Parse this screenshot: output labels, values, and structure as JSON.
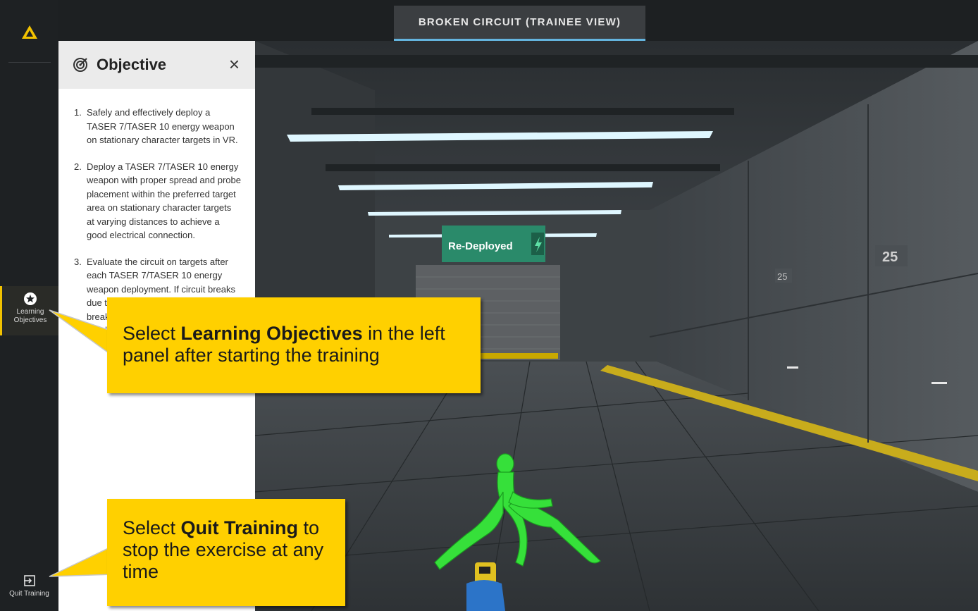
{
  "app": {
    "title": "BROKEN CIRCUIT (TRAINEE VIEW)"
  },
  "rail": {
    "logo_icon": "warning-triangle-logo",
    "learning_objectives_label": "Learning Objectives",
    "learning_objectives_icon": "star-circle-icon",
    "quit_label": "Quit Training",
    "quit_icon": "exit-icon"
  },
  "objective_panel": {
    "title": "Objective",
    "close_icon": "close-icon",
    "close_glyph": "×",
    "items": [
      {
        "num": "1.",
        "text": "Safely and effectively deploy a TASER 7/TASER 10 energy weapon on stationary character targets in VR."
      },
      {
        "num": "2.",
        "text": "Deploy a TASER 7/TASER 10 energy weapon with proper spread and probe placement within the preferred target area on stationary character targets at varying distances to achieve a good electrical connection."
      },
      {
        "num": "3.",
        "text": "Evaluate the circuit on targets after each TASER 7/TASER 10 energy weapon deployment. If circuit breaks due to probe bounce, disconnect, or breakage, re-deploy to achieve a good electrical connection."
      }
    ]
  },
  "scene": {
    "status_sign": "Re-Deployed",
    "status_icon": "lightning-bolt-icon",
    "lane_marker_1": "25",
    "lane_marker_2": "25",
    "accent_color": "#2a8a6a"
  },
  "callouts": {
    "learning": {
      "pre": "Select ",
      "bold": "Learning Objectives",
      "post": " in the left panel after starting the training"
    },
    "quit": {
      "pre": "Select ",
      "bold": "Quit Training",
      "post": " to stop the exercise at any time"
    }
  },
  "colors": {
    "callout": "#ffd000",
    "rail_active": "#f2c200",
    "tab_underline": "#64b4de"
  }
}
